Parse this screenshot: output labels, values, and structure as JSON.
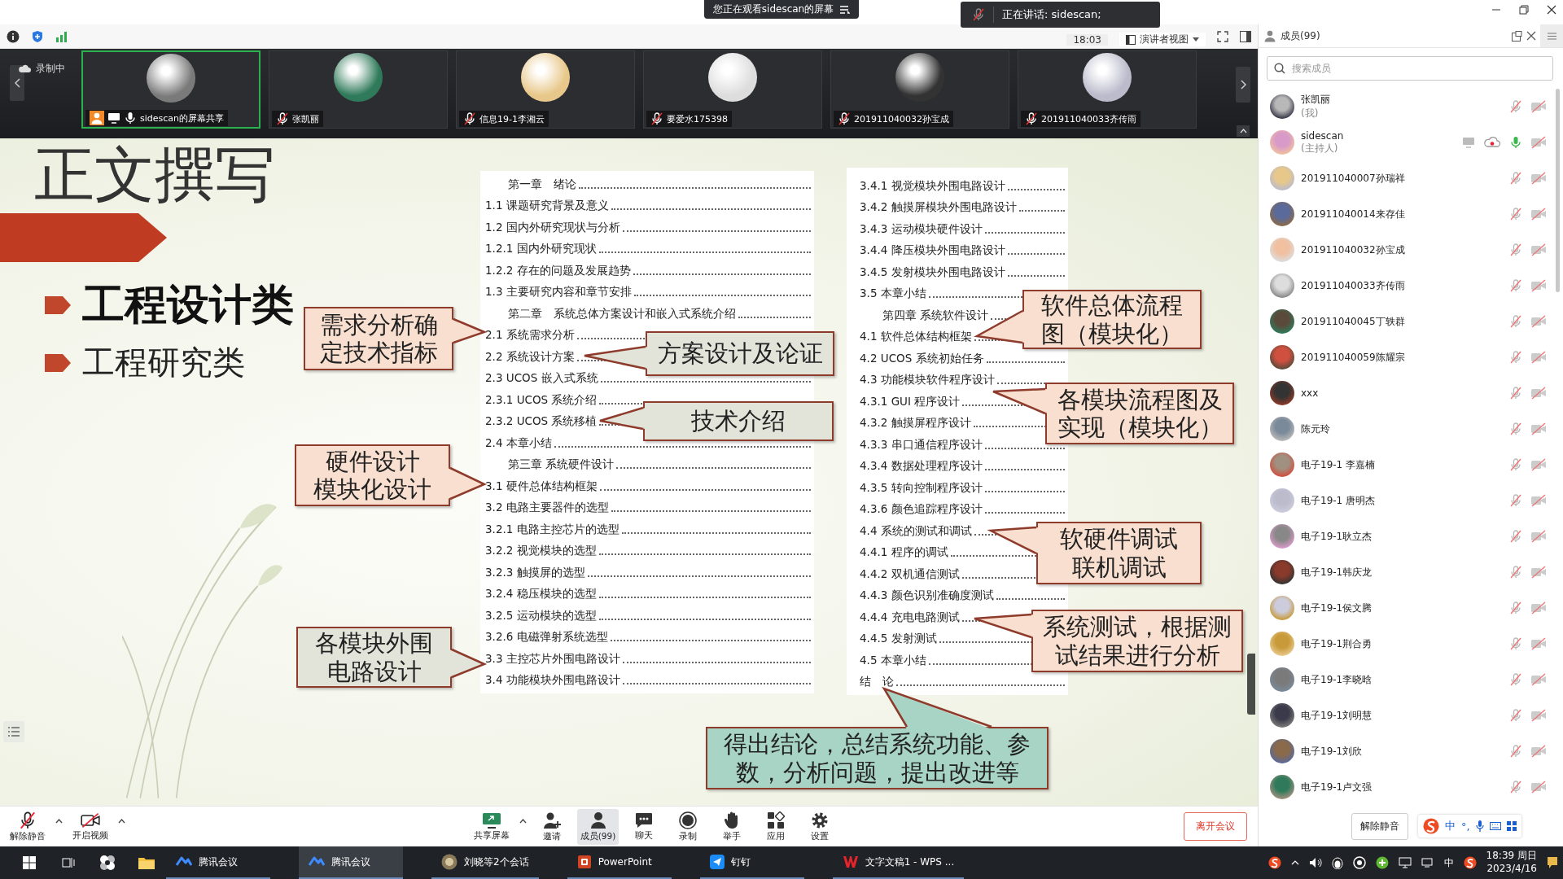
{
  "banner": {
    "text": "您正在观看sidescan的屏幕"
  },
  "speaking_toast": {
    "text": "正在讲话: sidescan;"
  },
  "meeting_bar": {
    "time": "18:03",
    "view_mode": "演讲者视图"
  },
  "video_strip": {
    "status": "录制中",
    "tiles": [
      {
        "name": "sidescan的屏幕共享",
        "selected": true,
        "muted": false,
        "sharing": true
      },
      {
        "name": "张凯丽",
        "selected": false,
        "muted": true,
        "sharing": false
      },
      {
        "name": "信息19-1李湘云",
        "selected": false,
        "muted": true,
        "sharing": false
      },
      {
        "name": "要爱水175398",
        "selected": false,
        "muted": true,
        "sharing": false
      },
      {
        "name": "201911040032孙宝成",
        "selected": false,
        "muted": true,
        "sharing": false
      },
      {
        "name": "201911040033齐传雨",
        "selected": false,
        "muted": true,
        "sharing": false
      }
    ]
  },
  "slide": {
    "title": "正文撰写",
    "bullets": [
      {
        "text": "工程设计类",
        "kind": "primary"
      },
      {
        "text": "工程研究类",
        "kind": "secondary"
      }
    ],
    "toc_columns": [
      {
        "items": [
          {
            "text": "第一章　绪论",
            "kind": "chapter"
          },
          {
            "text": "1.1 课题研究背景及意义",
            "kind": "section"
          },
          {
            "text": "1.2 国内外研究现状与分析",
            "kind": "section"
          },
          {
            "text": "1.2.1 国内外研究现状",
            "kind": "section"
          },
          {
            "text": "1.2.2 存在的问题及发展趋势",
            "kind": "section"
          },
          {
            "text": "1.3 主要研究内容和章节安排",
            "kind": "section"
          },
          {
            "text": "第二章　系统总体方案设计和嵌入式系统介绍",
            "kind": "chapter"
          },
          {
            "text": "2.1 系统需求分析",
            "kind": "section"
          },
          {
            "text": "2.2 系统设计方案",
            "kind": "section"
          },
          {
            "text": "2.3 UCOS 嵌入式系统",
            "kind": "section"
          },
          {
            "text": "2.3.1 UCOS 系统介绍",
            "kind": "section"
          },
          {
            "text": "2.3.2 UCOS 系统移植",
            "kind": "section"
          },
          {
            "text": "2.4 本章小结",
            "kind": "section"
          },
          {
            "text": "第三章 系统硬件设计",
            "kind": "chapter"
          },
          {
            "text": "3.1 硬件总体结构框架",
            "kind": "section"
          },
          {
            "text": "3.2 电路主要器件的选型",
            "kind": "section"
          },
          {
            "text": "3.2.1 电路主控芯片的选型",
            "kind": "section"
          },
          {
            "text": "3.2.2 视觉模块的选型",
            "kind": "section"
          },
          {
            "text": "3.2.3 触摸屏的选型",
            "kind": "section"
          },
          {
            "text": "3.2.4 稳压模块的选型",
            "kind": "section"
          },
          {
            "text": "3.2.5 运动模块的选型",
            "kind": "section"
          },
          {
            "text": "3.2.6 电磁弹射系统选型",
            "kind": "section"
          },
          {
            "text": "3.3 主控芯片外围电路设计",
            "kind": "section"
          },
          {
            "text": "3.4 功能模块外围电路设计",
            "kind": "section"
          }
        ]
      },
      {
        "items": [
          {
            "text": "3.4.1 视觉模块外围电路设计",
            "kind": "section"
          },
          {
            "text": "3.4.2 触摸屏模块外围电路设计",
            "kind": "section"
          },
          {
            "text": "3.4.3 运动模块硬件设计",
            "kind": "section"
          },
          {
            "text": "3.4.4 降压模块外围电路设计",
            "kind": "section"
          },
          {
            "text": "3.4.5 发射模块外围电路设计",
            "kind": "section"
          },
          {
            "text": "3.5 本章小结",
            "kind": "section"
          },
          {
            "text": "第四章 系统软件设计",
            "kind": "chapter"
          },
          {
            "text": "4.1 软件总体结构框架",
            "kind": "section"
          },
          {
            "text": "4.2 UCOS 系统初始任务",
            "kind": "section"
          },
          {
            "text": "4.3 功能模块软件程序设计",
            "kind": "section"
          },
          {
            "text": "4.3.1 GUI 程序设计",
            "kind": "section"
          },
          {
            "text": "4.3.2 触摸屏程序设计",
            "kind": "section"
          },
          {
            "text": "4.3.3 串口通信程序设计",
            "kind": "section"
          },
          {
            "text": "4.3.4 数据处理程序设计",
            "kind": "section"
          },
          {
            "text": "4.3.5 转向控制程序设计",
            "kind": "section"
          },
          {
            "text": "4.3.6 颜色追踪程序设计",
            "kind": "section"
          },
          {
            "text": "4.4 系统的测试和调试",
            "kind": "section"
          },
          {
            "text": "4.4.1 程序的调试",
            "kind": "section"
          },
          {
            "text": "4.4.2 双机通信测试",
            "kind": "section"
          },
          {
            "text": "4.4.3 颜色识别准确度测试",
            "kind": "section"
          },
          {
            "text": "4.4.4 充电电路测试",
            "kind": "section"
          },
          {
            "text": "4.4.5 发射测试",
            "kind": "section"
          },
          {
            "text": "4.5 本章小结",
            "kind": "section"
          },
          {
            "text": "结　论",
            "kind": "section"
          }
        ]
      }
    ],
    "callouts": [
      {
        "lines": [
          "需求分析确",
          "定技术指标"
        ],
        "color": "#f9dfcf"
      },
      {
        "lines": [
          "方案设计及论证"
        ],
        "color": "#e2e4da"
      },
      {
        "lines": [
          "技术介绍"
        ],
        "color": "#e2e4da"
      },
      {
        "lines": [
          "硬件设计",
          "模块化设计"
        ],
        "color": "#f9dfcf"
      },
      {
        "lines": [
          "各模块外围",
          "电路设计"
        ],
        "color": "#e2e4da"
      },
      {
        "lines": [
          "软件总体流程",
          "图（模块化）"
        ],
        "color": "#f9dfcf"
      },
      {
        "lines": [
          "各模块流程图及",
          "实现（模块化）"
        ],
        "color": "#f9dfcf"
      },
      {
        "lines": [
          "软硬件调试",
          "联机调试"
        ],
        "color": "#f9dfcf"
      },
      {
        "lines": [
          "系统测试，根据测",
          "试结果进行分析"
        ],
        "color": "#f9dfcf"
      },
      {
        "lines": [
          "得出结论，总结系统功能、参",
          "数，分析问题，提出改进等"
        ],
        "color": "#a8d4c5"
      }
    ]
  },
  "members_panel": {
    "title": "成员(99)",
    "search": {
      "placeholder": "搜索成员"
    },
    "members": [
      {
        "name": "张凯丽",
        "role": "(我)",
        "muted": true,
        "video_on": false,
        "sharing": false,
        "recording": false
      },
      {
        "name": "sidescan",
        "role": "(主持人)",
        "muted": false,
        "video_on": false,
        "sharing": true,
        "recording": true
      },
      {
        "name": "201911040007孙瑞祥",
        "muted": true,
        "video_on": false,
        "sharing": false,
        "recording": false
      },
      {
        "name": "201911040014来存佳",
        "muted": true,
        "video_on": false,
        "sharing": false,
        "recording": false
      },
      {
        "name": "201911040032孙宝成",
        "muted": true,
        "video_on": false,
        "sharing": false,
        "recording": false
      },
      {
        "name": "201911040033齐传雨",
        "muted": true,
        "video_on": false,
        "sharing": false,
        "recording": false
      },
      {
        "name": "201911040045丁轶群",
        "muted": true,
        "video_on": false,
        "sharing": false,
        "recording": false
      },
      {
        "name": "201911040059陈耀宗",
        "muted": true,
        "video_on": false,
        "sharing": false,
        "recording": false
      },
      {
        "name": "xxx",
        "muted": true,
        "video_on": false,
        "sharing": false,
        "recording": false
      },
      {
        "name": "陈元玲",
        "muted": true,
        "video_on": false,
        "sharing": false,
        "recording": false
      },
      {
        "name": "电子19-1 李嘉楠",
        "muted": true,
        "video_on": false,
        "sharing": false,
        "recording": false
      },
      {
        "name": "电子19-1 唐明杰",
        "muted": true,
        "video_on": false,
        "sharing": false,
        "recording": false
      },
      {
        "name": "电子19-1耿立杰",
        "muted": true,
        "video_on": false,
        "sharing": false,
        "recording": false
      },
      {
        "name": "电子19-1韩庆龙",
        "muted": true,
        "video_on": false,
        "sharing": false,
        "recording": false
      },
      {
        "name": "电子19-1侯文腾",
        "muted": true,
        "video_on": false,
        "sharing": false,
        "recording": false
      },
      {
        "name": "电子19-1荆合勇",
        "muted": true,
        "video_on": false,
        "sharing": false,
        "recording": false
      },
      {
        "name": "电子19-1李晓晗",
        "muted": true,
        "video_on": false,
        "sharing": false,
        "recording": false
      },
      {
        "name": "电子19-1刘明慧",
        "muted": true,
        "video_on": false,
        "sharing": false,
        "recording": false
      },
      {
        "name": "电子19-1刘欣",
        "muted": true,
        "video_on": false,
        "sharing": false,
        "recording": false
      },
      {
        "name": "电子19-1卢文强",
        "muted": true,
        "video_on": false,
        "sharing": false,
        "recording": false
      }
    ],
    "unmute_all": "解除静音"
  },
  "ime": {
    "mode": "中",
    "punctuation": "°,"
  },
  "bottom_toolbar": {
    "items": [
      {
        "label": "解除静音",
        "kind": "mic",
        "menu": true,
        "selected": false
      },
      {
        "label": "开启视频",
        "kind": "camera",
        "menu": true,
        "selected": false
      },
      {
        "label": "共享屏幕",
        "kind": "share",
        "menu": true,
        "selected": false
      },
      {
        "label": "邀请",
        "kind": "invite",
        "menu": false,
        "selected": false
      },
      {
        "label": "成员(99)",
        "kind": "members",
        "menu": false,
        "selected": true
      },
      {
        "label": "聊天",
        "kind": "chat",
        "menu": false,
        "selected": false
      },
      {
        "label": "录制",
        "kind": "record",
        "menu": false,
        "selected": false
      },
      {
        "label": "举手",
        "kind": "hand",
        "menu": false,
        "selected": false
      },
      {
        "label": "应用",
        "kind": "apps",
        "menu": false,
        "selected": false
      },
      {
        "label": "设置",
        "kind": "settings",
        "menu": false,
        "selected": false
      }
    ],
    "leave": "离开会议"
  },
  "taskbar": {
    "tasks": [
      {
        "label": "腾讯会议",
        "kind": "meeting",
        "selected": false
      },
      {
        "label": "腾讯会议",
        "kind": "meeting",
        "selected": true
      },
      {
        "label": "刘晓等2个会话",
        "kind": "chat",
        "selected": false
      },
      {
        "label": "PowerPoint",
        "kind": "ppt",
        "selected": false
      },
      {
        "label": "钉钉",
        "kind": "dingtalk",
        "selected": false
      },
      {
        "label": "文字文稿1 - WPS ...",
        "kind": "wps",
        "selected": false
      }
    ],
    "input_mode": "中",
    "time": "18:39 周日",
    "date": "2023/4/16"
  }
}
